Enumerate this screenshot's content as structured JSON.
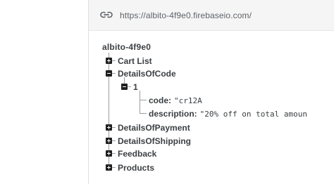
{
  "url_bar": {
    "icon": "link-icon",
    "url": "https://albito-4f9e0.firebaseio.com/"
  },
  "tree": {
    "root": "albito-4f9e0",
    "nodes": [
      {
        "label": "Cart List",
        "state": "collapsed"
      },
      {
        "label": "DetailsOfCode",
        "state": "expanded"
      },
      {
        "label": "DetailsOfPayment",
        "state": "collapsed"
      },
      {
        "label": "DetailsOfShipping",
        "state": "collapsed"
      },
      {
        "label": "Feedback",
        "state": "collapsed"
      },
      {
        "label": "Products",
        "state": "collapsed"
      }
    ],
    "child": {
      "label": "1",
      "state": "expanded",
      "fields": [
        {
          "key": "code:",
          "value": "\"cr12A"
        },
        {
          "key": "description:",
          "value": "\"20% off on total amoun"
        }
      ]
    }
  }
}
